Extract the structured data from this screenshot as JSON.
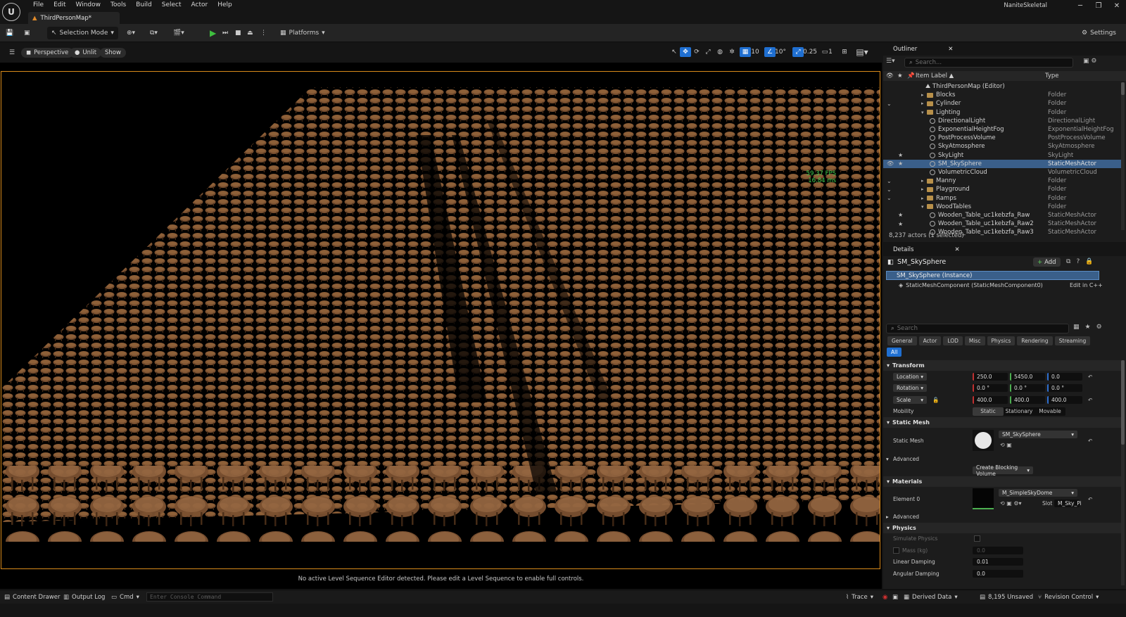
{
  "window": {
    "menu": [
      "File",
      "Edit",
      "Window",
      "Tools",
      "Build",
      "Select",
      "Actor",
      "Help"
    ],
    "tab": "ThirdPersonMap*",
    "project": "NaniteSkeletal",
    "logo": "U"
  },
  "toolbar": {
    "selection_mode": "Selection Mode",
    "platforms": "Platforms",
    "settings": "Settings"
  },
  "viewport": {
    "perspective": "Perspective",
    "unlit": "Unlit",
    "show": "Show",
    "grid_snap": "10",
    "rot_snap": "10°",
    "scale_snap": "0.25",
    "camera_speed": "1",
    "fps": "59.37 FPS",
    "ms": "16.84 ms",
    "scene_text": "",
    "sequence_message": "No active Level Sequence Editor detected. Please edit a Level Sequence to enable full controls."
  },
  "outliner": {
    "title": "Outliner",
    "search_placeholder": "Search...",
    "col_label": "Item Label ▲",
    "col_type": "Type",
    "root": "ThirdPersonMap (Editor)",
    "rows": [
      {
        "label": "Blocks",
        "type": "Folder"
      },
      {
        "label": "Cylinder",
        "type": "Folder"
      },
      {
        "label": "Lighting",
        "type": "Folder"
      },
      {
        "label": "DirectionalLight",
        "type": "DirectionalLight"
      },
      {
        "label": "ExponentialHeightFog",
        "type": "ExponentialHeightFog"
      },
      {
        "label": "PostProcessVolume",
        "type": "PostProcessVolume"
      },
      {
        "label": "SkyAtmosphere",
        "type": "SkyAtmosphere"
      },
      {
        "label": "SkyLight",
        "type": "SkyLight"
      },
      {
        "label": "SM_SkySphere",
        "type": "StaticMeshActor"
      },
      {
        "label": "VolumetricCloud",
        "type": "VolumetricCloud"
      },
      {
        "label": "Manny",
        "type": "Folder"
      },
      {
        "label": "Playground",
        "type": "Folder"
      },
      {
        "label": "Ramps",
        "type": "Folder"
      },
      {
        "label": "WoodTables",
        "type": "Folder"
      },
      {
        "label": "Wooden_Table_uc1kebzfa_Raw",
        "type": "StaticMeshActor"
      },
      {
        "label": "Wooden_Table_uc1kebzfa_Raw2",
        "type": "StaticMeshActor"
      },
      {
        "label": "Wooden_Table_uc1kebzfa_Raw3",
        "type": "StaticMeshActor"
      }
    ],
    "status": "8,237 actors (1 selected)"
  },
  "details": {
    "title": "Details",
    "actor": "SM_SkySphere",
    "add": "Add",
    "instance": "SM_SkySphere (Instance)",
    "component": "StaticMeshComponent (StaticMeshComponent0)",
    "edit_cpp": "Edit in C++",
    "search_placeholder": "Search",
    "tabs": [
      "General",
      "Actor",
      "LOD",
      "Misc",
      "Physics",
      "Rendering",
      "Streaming"
    ],
    "tab_all": "All",
    "transform": "Transform",
    "location_label": "Location",
    "location": [
      "250.0",
      "5450.0",
      "0.0"
    ],
    "rotation_label": "Rotation",
    "rotation": [
      "0.0 °",
      "0.0 °",
      "0.0 °"
    ],
    "scale_label": "Scale",
    "scale": [
      "400.0",
      "400.0",
      "400.0"
    ],
    "mobility_label": "Mobility",
    "mobility": [
      "Static",
      "Stationary",
      "Movable"
    ],
    "static_mesh_section": "Static Mesh",
    "static_mesh_label": "Static Mesh",
    "static_mesh_value": "SM_SkySphere",
    "advanced": "Advanced",
    "blocking_volume": "Create Blocking Volume",
    "materials": "Materials",
    "element0": "Element 0",
    "material_value": "M_SimpleSkyDome",
    "slot_label": "Slot",
    "slot_value": "M_Sky_Pi",
    "advanced2": "Advanced",
    "physics": "Physics",
    "simulate_physics": "Simulate Physics",
    "mass": "Mass (kg)",
    "mass_value": "0.0",
    "linear_damping": "Linear Damping",
    "linear_damping_value": "0.01",
    "angular_damping": "Angular Damping",
    "angular_damping_value": "0.0"
  },
  "bottom": {
    "content_drawer": "Content Drawer",
    "output_log": "Output Log",
    "cmd": "Cmd",
    "console_placeholder": "Enter Console Command",
    "trace": "Trace",
    "derived_data": "Derived Data",
    "unsaved": "8,195 Unsaved",
    "revision_control": "Revision Control"
  },
  "colors": {
    "accent_blue": "#1f6fd1",
    "viewport_border": "#d98a1a",
    "selection": "#3a5f8a",
    "table_wood": "#7a5030"
  }
}
